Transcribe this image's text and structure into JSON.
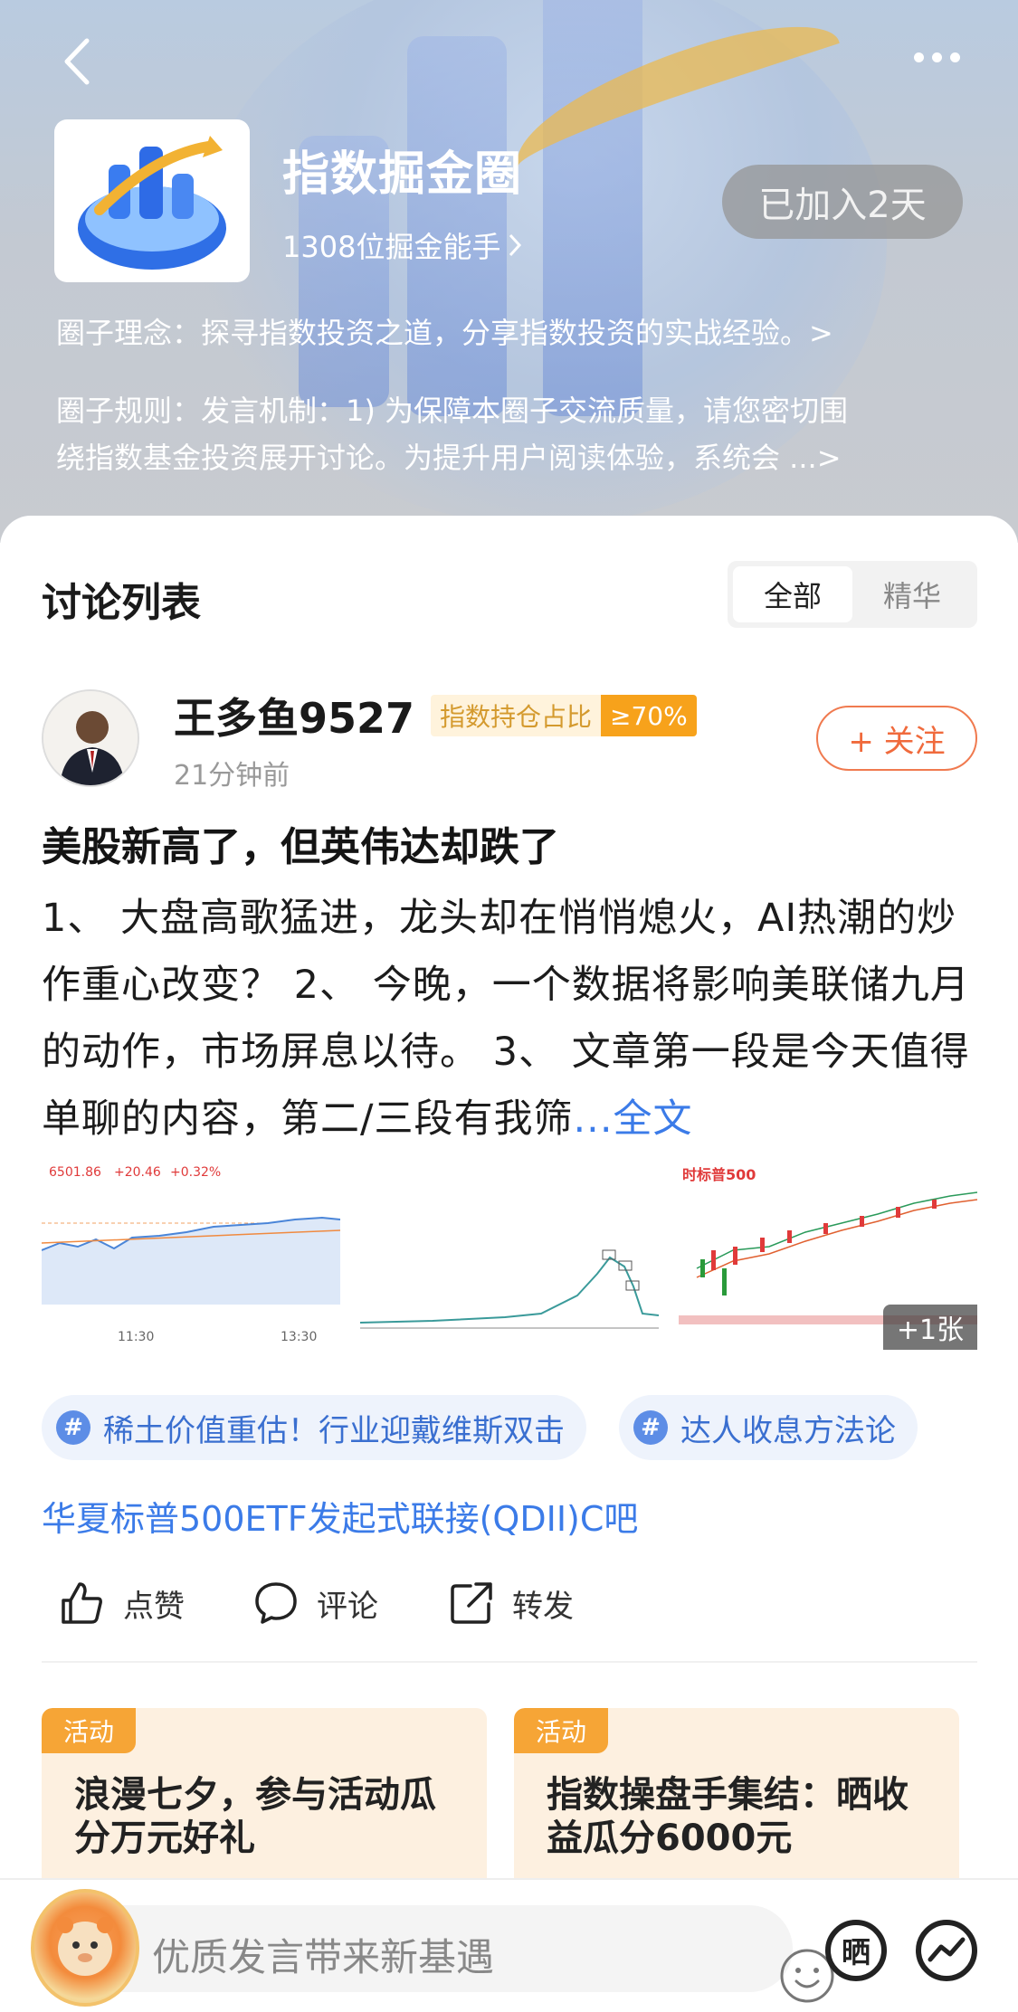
{
  "header": {
    "group_name": "指数掘金圈",
    "members": "1308位掘金能手",
    "joined": "已加入2天",
    "philosophy": "圈子理念：探寻指数投资之道，分享指数投资的实战经验。>",
    "rules_line1": "圈子规则：发言机制：1) 为保障本圈子交流质量，请您密切围",
    "rules_line2": "绕指数基金投资展开讨论。为提升用户阅读体验，系统会 ...>"
  },
  "discussion": {
    "title": "讨论列表",
    "tabs": [
      {
        "label": "全部",
        "active": true
      },
      {
        "label": "精华",
        "active": false
      }
    ]
  },
  "post": {
    "author": "王多鱼9527",
    "holding_label": "指数持仓占比",
    "holding_value": "≥70%",
    "time": "21分钟前",
    "follow": "+ 关注",
    "title": "美股新高了，但英伟达却跌了",
    "body": "1、 大盘高歌猛进，龙头却在悄悄熄火，AI热潮的炒作重心改变？ 2、 今晚，一个数据将影响美联储九月的动作，市场屏息以待。 3、 文章第一段是今天值得单聊的内容，第二/三段有我筛",
    "full_text": "...全文",
    "images": {
      "chart1_price": "6501.86",
      "chart1_change": "+20.46",
      "chart1_pct": "+0.32%",
      "chart1_t1": "11:30",
      "chart1_t2": "13:30",
      "chart3_title": "时标普500",
      "more": "+1张"
    },
    "topics": [
      "稀土价值重估！行业迎戴维斯双击",
      "达人收息方法论"
    ],
    "fund_link": "华夏标普500ETF发起式联接(QDII)C吧",
    "actions": {
      "like": "点赞",
      "comment": "评论",
      "share": "转发"
    }
  },
  "activities": [
    {
      "tag": "活动",
      "title": "浪漫七夕，参与活动瓜分万元好礼"
    },
    {
      "tag": "活动",
      "title": "指数操盘手集结：晒收益瓜分6000元"
    }
  ],
  "bottom": {
    "placeholder": "优质发言带来新基遇",
    "shai": "晒"
  }
}
